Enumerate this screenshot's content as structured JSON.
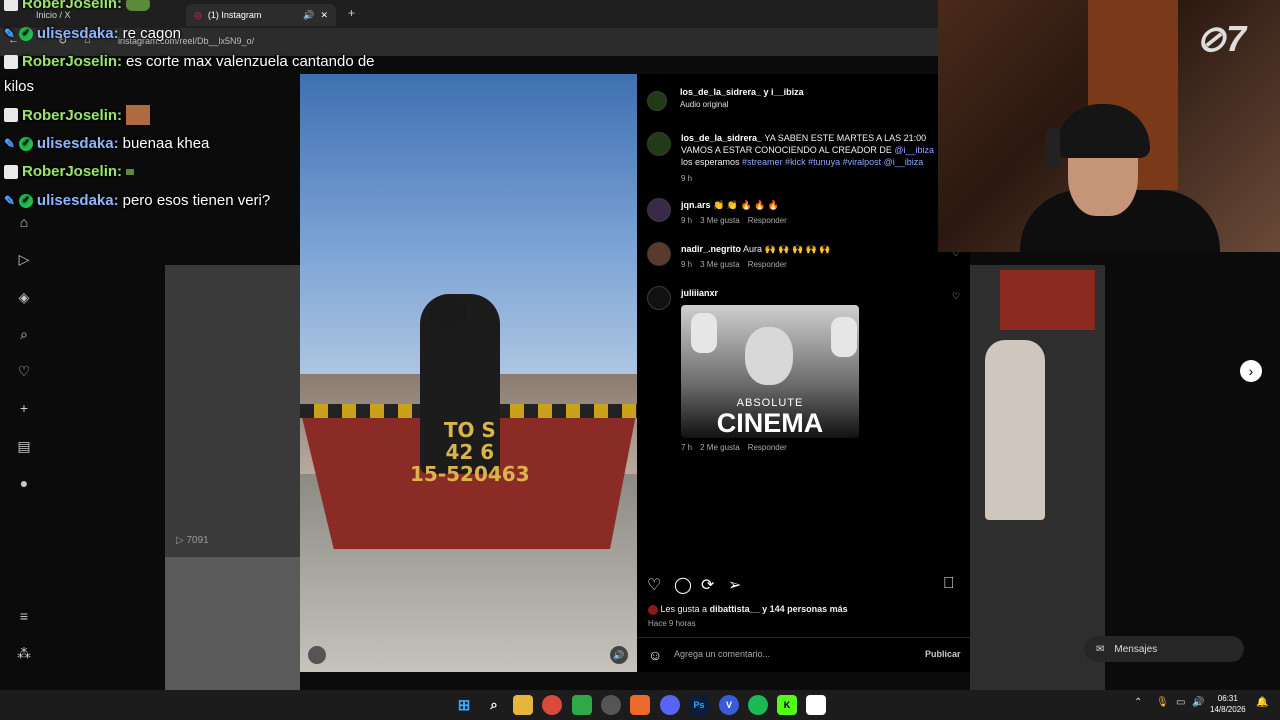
{
  "browser": {
    "tabs": [
      {
        "label": "Inicio / X"
      },
      {
        "label": "(1) Instagram"
      }
    ],
    "new_tab": "+",
    "url": "instagram.com/reel/Db__lx5N9_o/"
  },
  "chat": [
    {
      "user": "RoberJoselin:",
      "message": "",
      "user_color": "#9be66a"
    },
    {
      "user": "ulisesdaka:",
      "message": "re cagon",
      "user_color": "#8fb6ff"
    },
    {
      "user": "RoberJoselin:",
      "message": "es corte max valenzuela cantando de",
      "message2": "kilos",
      "user_color": "#9be66a"
    },
    {
      "user": "RoberJoselin:",
      "message": "",
      "user_color": "#9be66a"
    },
    {
      "user": "ulisesdaka:",
      "message": "buenaa khea",
      "user_color": "#8fb6ff"
    },
    {
      "user": "RoberJoselin:",
      "message": "",
      "user_color": "#9be66a"
    },
    {
      "user": "ulisesdaka:",
      "message": "pero esos tienen veri?",
      "user_color": "#8fb6ff"
    }
  ],
  "video": {
    "sign_text_1": "TO    S",
    "sign_text_2": "42     6",
    "sign_text_3": "15-520463",
    "views": "7091"
  },
  "post": {
    "author": "los_de_la_sidrera_ y i__ibiza",
    "audio": "Audio original",
    "caption_user": "los_de_la_sidrera_",
    "caption_text": "YA SABEN ESTE MARTES A LAS 21:00 VAMOS A ESTAR CONOCIENDO AL CREADOR DE",
    "caption_mention": "@i__ibiza",
    "caption_text2": "los esperamos",
    "caption_tags": "#streamer #kick #tunuya #viralpost @i__ibiza",
    "caption_time": "9 h"
  },
  "comments": [
    {
      "user": "jqn.ars",
      "text": "👏 👏 🔥 🔥 🔥",
      "time": "9 h",
      "likes": "3 Me gusta",
      "reply": "Responder"
    },
    {
      "user": "nadir_.negrito",
      "text": "Aura 🙌 🙌 🙌 🙌 🙌",
      "time": "9 h",
      "likes": "3 Me gusta",
      "reply": "Responder"
    },
    {
      "user": "juliiianxr",
      "text": "",
      "time": "7 h",
      "likes": "2 Me gusta",
      "reply": "Responder"
    }
  ],
  "meme": {
    "line1": "ABSOLUTE",
    "line2": "CINEMA"
  },
  "likes": {
    "text_pre": "Les gusta a",
    "user": "dibattista__",
    "text_post": "y 144 personas más",
    "when": "Hace 9 horas"
  },
  "comment_box": {
    "placeholder": "Agrega un comentario...",
    "publish": "Publicar"
  },
  "messages_button": "Mensajes",
  "taskbar": {
    "time": "06:31",
    "date": "14/8/2026"
  },
  "icons": {
    "left_nav": [
      "home-icon",
      "reels-icon",
      "explore-icon",
      "search-icon",
      "heart-icon",
      "create-icon",
      "stats-icon",
      "profile-icon",
      "menu-icon",
      "apps-icon"
    ],
    "actions": [
      "heart-icon",
      "comment-icon",
      "repost-icon",
      "share-icon",
      "bookmark-icon"
    ]
  },
  "colors": {
    "link": "#8ea6ff",
    "chat_green": "#9be66a",
    "chat_blue": "#8fb6ff"
  }
}
